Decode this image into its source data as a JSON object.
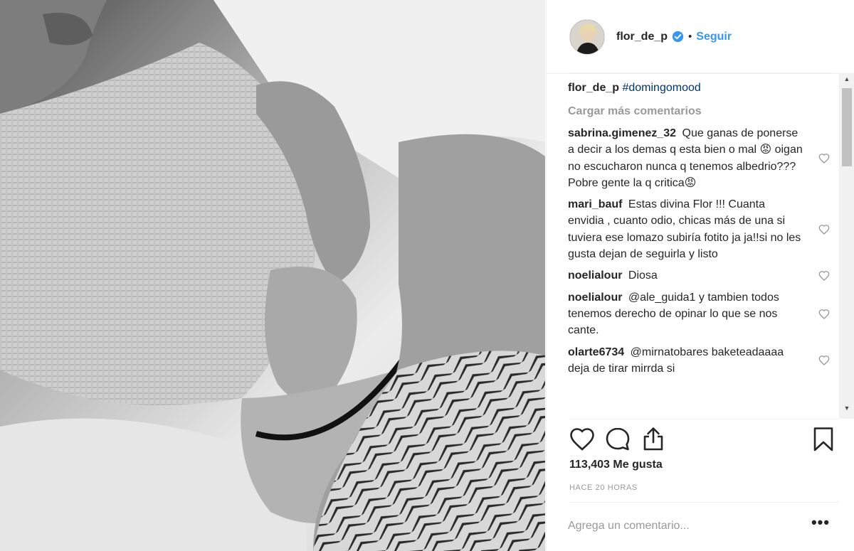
{
  "post": {
    "username": "flor_de_p",
    "separator": "•",
    "follow_label": "Seguir",
    "caption_user": "flor_de_p",
    "caption_text": "#domingomood",
    "load_more_label": "Cargar más comentarios",
    "comments": [
      {
        "user": "sabrina.gimenez_32",
        "text": "Que ganas de ponerse a decir a los demas q esta bien o mal 😡 oigan no escucharon nunca q tenemos albedrio??? Pobre gente la q critica😡"
      },
      {
        "user": "mari_bauf",
        "text": "Estas divina Flor !!! Cuanta envidia , cuanto odio, chicas más de una si tuviera ese lomazo subiría fotito ja ja!!si no les gusta dejan de seguirla y listo"
      },
      {
        "user": "noelialour",
        "text": "Diosa"
      },
      {
        "user": "noelialour",
        "text": "@ale_guida1 y tambien todos tenemos derecho de opinar lo que se nos cante."
      },
      {
        "user": "olarte6734",
        "text": "@mirnatobares baketeadaaaa deja de tirar mirrda si"
      }
    ],
    "likes_label": "113,403 Me gusta",
    "time_label": "HACE 20 HORAS",
    "add_comment_placeholder": "Agrega un comentario...",
    "more_label": "•••"
  },
  "icons": {
    "like": "heart-outline-icon",
    "comment": "speech-bubble-icon",
    "share": "share-upload-icon",
    "save": "bookmark-icon",
    "verified": "verified-badge-icon"
  },
  "colors": {
    "link_blue": "#3897f0",
    "hashtag_blue": "#003569",
    "muted_gray": "#999999",
    "text": "#262626"
  }
}
